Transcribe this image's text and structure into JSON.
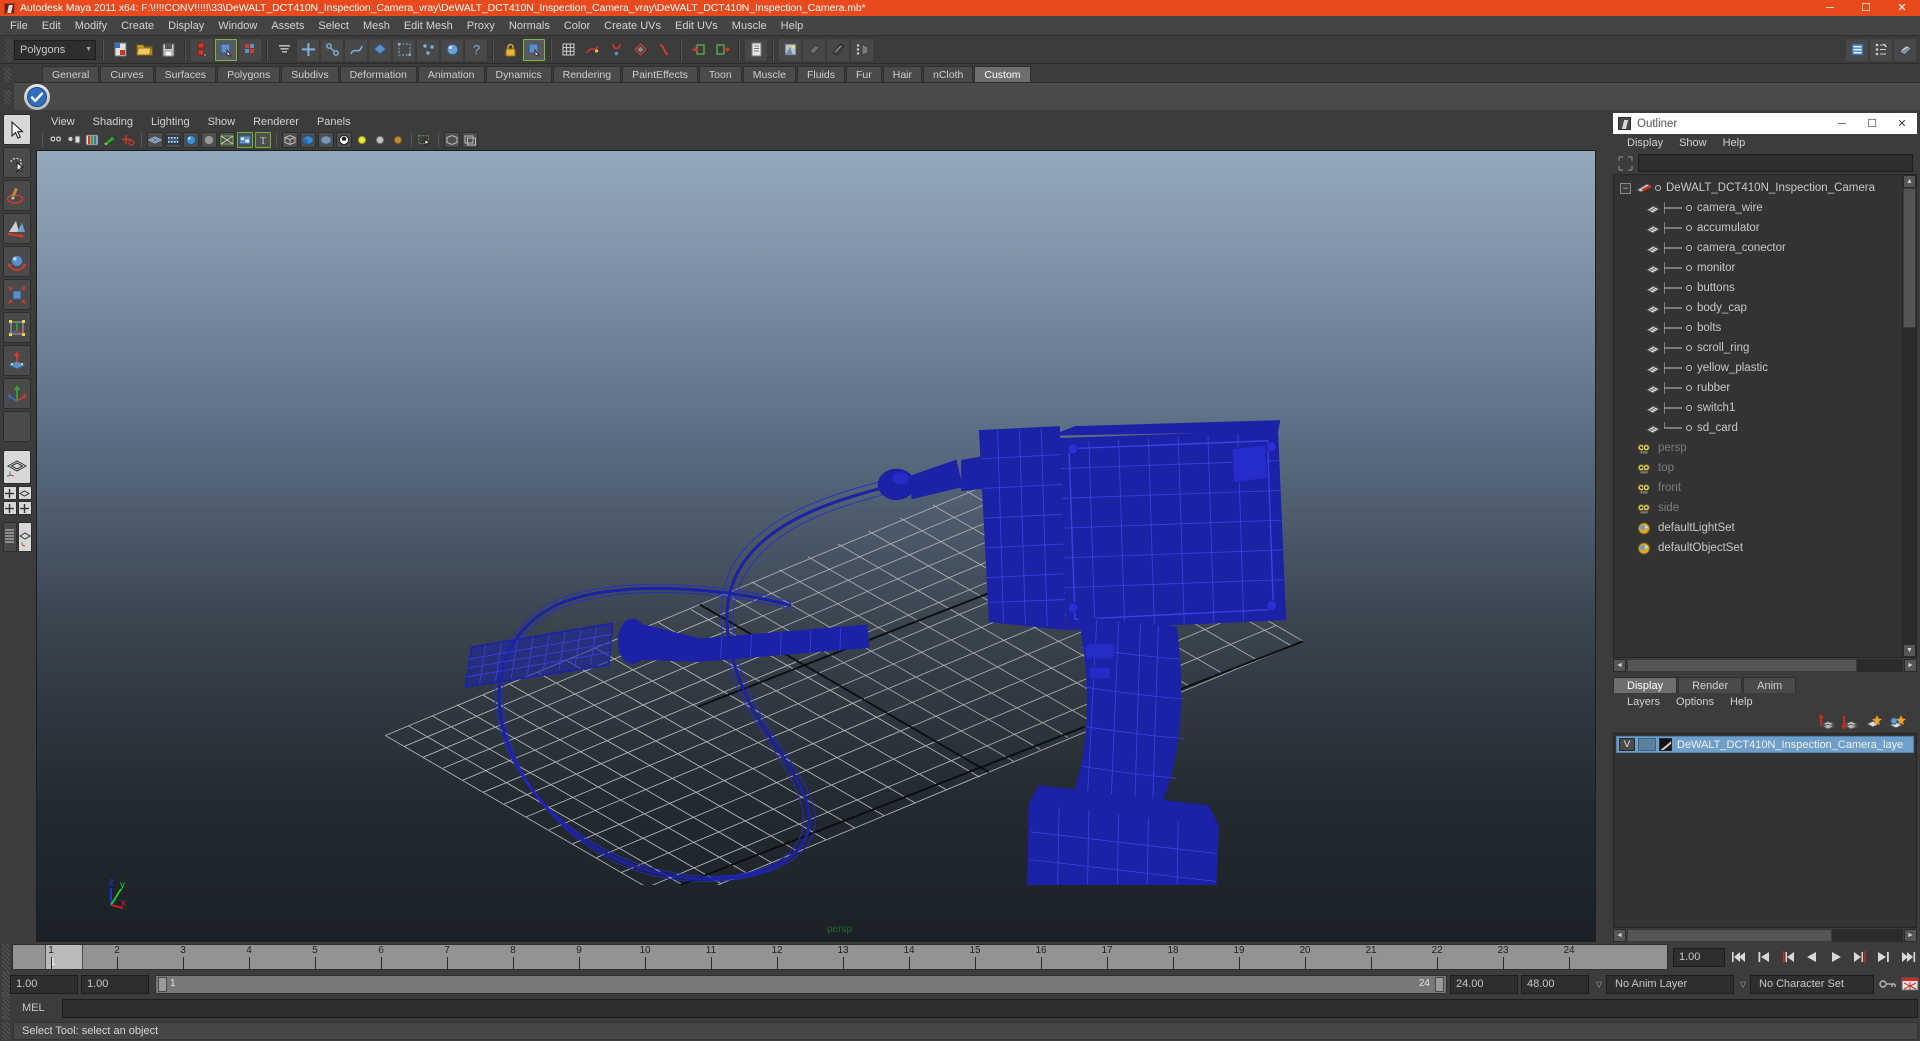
{
  "window": {
    "title": "Autodesk Maya 2011 x64: F:\\!!!!CONV!!!!!\\33\\DeWALT_DCT410N_Inspection_Camera_vray\\DeWALT_DCT410N_Inspection_Camera_vray\\DeWALT_DCT410N_Inspection_Camera.mb*",
    "minimize": "─",
    "maximize": "☐",
    "close": "✕",
    "accent_color": "#e8491d"
  },
  "menubar": {
    "items": [
      "File",
      "Edit",
      "Modify",
      "Create",
      "Display",
      "Window",
      "Assets",
      "Select",
      "Mesh",
      "Edit Mesh",
      "Proxy",
      "Normals",
      "Color",
      "Create UVs",
      "Edit UVs",
      "Muscle",
      "Help"
    ]
  },
  "statusbar": {
    "mode_value": "Polygons",
    "mode_arrow": "▼"
  },
  "shelf": {
    "tabs": [
      "General",
      "Curves",
      "Surfaces",
      "Polygons",
      "Subdivs",
      "Deformation",
      "Animation",
      "Dynamics",
      "Rendering",
      "PaintEffects",
      "Toon",
      "Muscle",
      "Fluids",
      "Fur",
      "Hair",
      "nCloth",
      "Custom"
    ],
    "active_tab": "Custom"
  },
  "viewport": {
    "menus": [
      "View",
      "Shading",
      "Lighting",
      "Show",
      "Renderer",
      "Panels"
    ],
    "camera_label": "persp",
    "axis_x": "x",
    "axis_y": "y",
    "axis_z": "z",
    "background_top": "#95a9bd",
    "background_bottom": "#1b2127",
    "wireframe_color": "#1a1f9e",
    "grid_color": "#b0b0b0",
    "grid_axis_color": "#101010"
  },
  "outliner": {
    "title": "Outliner",
    "window_buttons": {
      "minimize": "─",
      "maximize": "☐",
      "close": "✕"
    },
    "menus": [
      "Display",
      "Show",
      "Help"
    ],
    "search_value": "",
    "search_placeholder": "",
    "root": {
      "label": "DeWALT_DCT410N_Inspection_Camera",
      "expander": "−"
    },
    "children": [
      "camera_wire",
      "accumulator",
      "camera_conector",
      "monitor",
      "buttons",
      "body_cap",
      "bolts",
      "scroll_ring",
      "yellow_plastic",
      "rubber",
      "switch1",
      "sd_card"
    ],
    "cameras": [
      "persp",
      "top",
      "front",
      "side"
    ],
    "sets": [
      "defaultLightSet",
      "defaultObjectSet"
    ],
    "scroll_up": "▲",
    "scroll_down": "▼",
    "scroll_left": "◄",
    "scroll_right": "►"
  },
  "layer_editor": {
    "tabs": [
      "Display",
      "Render",
      "Anim"
    ],
    "active_tab": "Display",
    "menus": [
      "Layers",
      "Options",
      "Help"
    ],
    "layers": [
      {
        "visibility": "V",
        "type": "",
        "name": "DeWALT_DCT410N_Inspection_Camera_laye"
      }
    ],
    "scroll_left": "◄",
    "scroll_right": "►"
  },
  "timeslider": {
    "current_frame": "1",
    "current_field": "1.00",
    "ticks": [
      "1",
      "2",
      "3",
      "4",
      "5",
      "6",
      "7",
      "8",
      "9",
      "10",
      "11",
      "12",
      "13",
      "14",
      "15",
      "16",
      "17",
      "18",
      "19",
      "20",
      "21",
      "22",
      "23",
      "24"
    ],
    "playback": [
      "⏮",
      "⏴",
      "⏴",
      "◀",
      "▶",
      "▶",
      "⏵",
      "⏭"
    ]
  },
  "rangeslider": {
    "start": "1.00",
    "start2": "1.00",
    "range_start": "1",
    "range_end": "24",
    "end": "24.00",
    "playback_end": "48.00",
    "anim_layer": "No Anim Layer",
    "character_set": "No Character Set",
    "combo_arrow": "▽"
  },
  "mel": {
    "label": "MEL",
    "value": "",
    "placeholder": ""
  },
  "helpline": {
    "message": "Select Tool: select an object"
  },
  "toolbox": {
    "tools": [
      "select-tool",
      "lasso-select-tool",
      "paint-select-tool",
      "move-tool",
      "rotate-tool",
      "scale-tool",
      "universal-manipulator",
      "soft-modification-tool",
      "show-manipulator-tool",
      "last-tool-used"
    ],
    "layouts": [
      "single-perspective-view",
      "four-view",
      "outliner-persp-view",
      "persp-graph-view",
      "hypershade-persp-view"
    ]
  }
}
